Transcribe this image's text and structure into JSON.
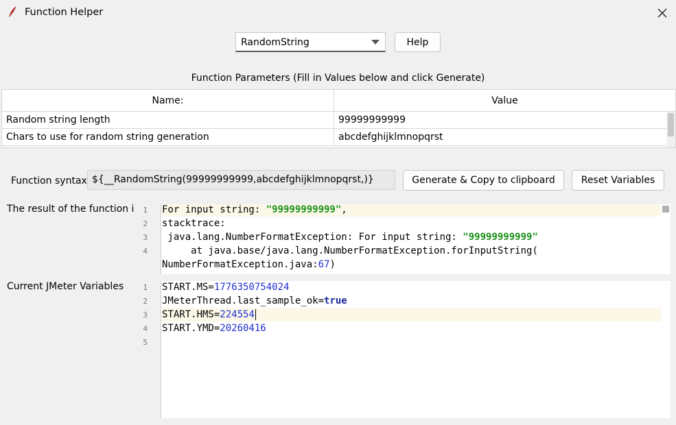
{
  "window": {
    "title": "Function Helper"
  },
  "function_select": {
    "selected": "RandomString"
  },
  "buttons": {
    "help": "Help",
    "generate": "Generate & Copy to clipboard",
    "reset": "Reset Variables"
  },
  "params": {
    "label": "Function Parameters (Fill in Values below and click Generate)",
    "headers": {
      "name": "Name:",
      "value": "Value"
    },
    "rows": [
      {
        "name": "Random string length",
        "value": "99999999999"
      },
      {
        "name": "Chars to use for random string generation",
        "value": "abcdefghijklmnopqrst"
      }
    ]
  },
  "syntax": {
    "label": "Function syntax:",
    "value": "${__RandomString(99999999999,abcdefghijklmnopqrst,)}"
  },
  "result": {
    "label": "The result of the function is",
    "line_numbers": [
      "1",
      "2",
      "3",
      "4"
    ],
    "lines": {
      "l1_a": "For input string: ",
      "l1_b": "\"99999999999\"",
      "l1_c": ",",
      "l2": "stacktrace:",
      "l3_a": " java.lang.NumberFormatException: For input string: ",
      "l3_b": "\"99999999999\"",
      "l4": "     at java.base/java.lang.NumberFormatException.forInputString(",
      "l5_a": "NumberFormatException.java:",
      "l5_b": "67",
      "l5_c": ")"
    }
  },
  "variables": {
    "label": "Current JMeter Variables",
    "line_numbers": [
      "1",
      "2",
      "3",
      "4",
      "5"
    ],
    "lines": [
      {
        "key": "START.MS=",
        "value": "1776350754024",
        "kind": "num"
      },
      {
        "key": "JMeterThread.last_sample_ok=",
        "value": "true",
        "kind": "kw"
      },
      {
        "key": "START.HMS=",
        "value": "224554",
        "kind": "num"
      },
      {
        "key": "START.YMD=",
        "value": "20260416",
        "kind": "num"
      }
    ]
  },
  "colors": {
    "string": "#1a8f1a",
    "number": "#1f2fcf",
    "keyword": "#1a2a9a",
    "current_line": "#fbf8e8"
  }
}
